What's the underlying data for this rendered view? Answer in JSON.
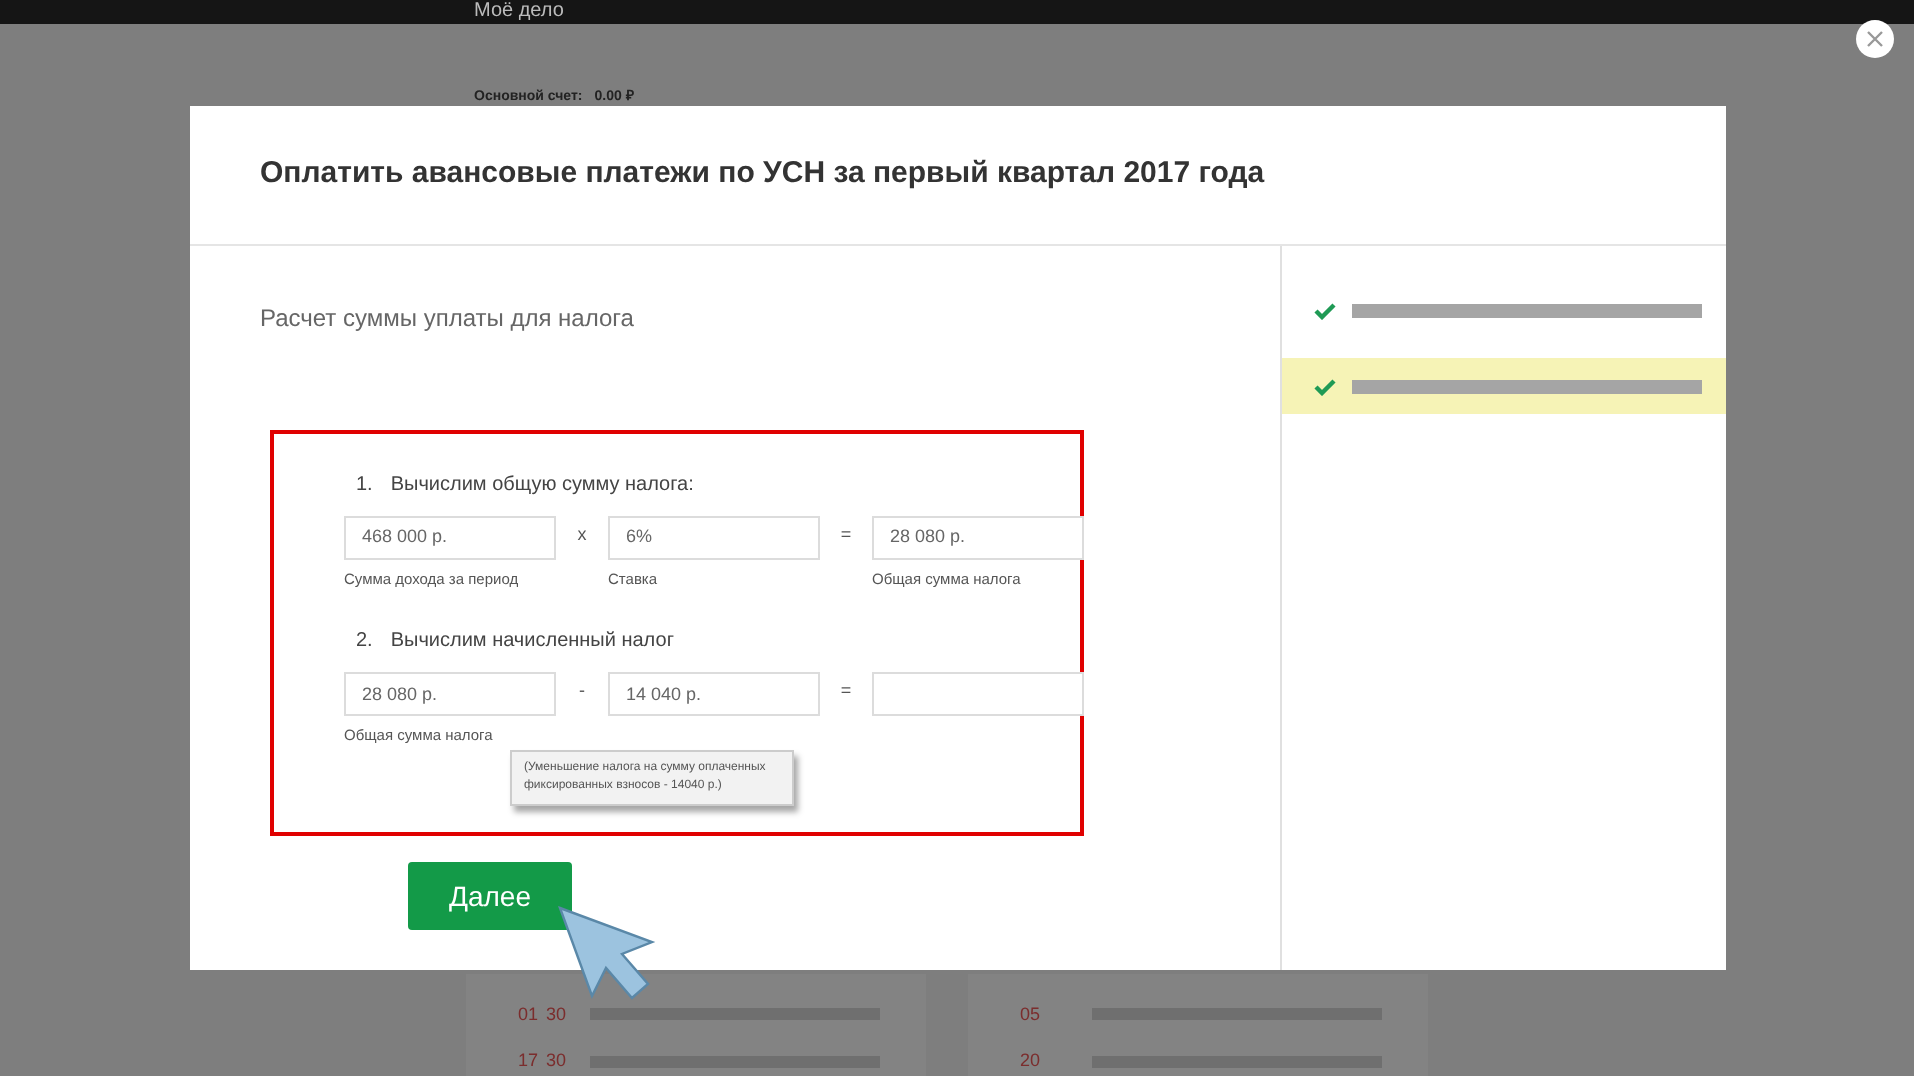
{
  "app_bar": {
    "title": "Моё дело"
  },
  "account": {
    "label": "Основной счет:",
    "value": "0.00 ₽"
  },
  "dialog": {
    "title": "Оплатить авансовые платежи по УСН за первый квартал 2017 года",
    "section_title": "Расчет суммы уплаты для налога",
    "steps": [
      {
        "number": "1.",
        "title": "Вычислим общую сумму налога:",
        "operands": [
          {
            "value": "468 000 р.",
            "caption": "Сумма дохода за период"
          },
          {
            "operator": "x",
            "value": "6%",
            "caption": "Ставка"
          },
          {
            "operator": "=",
            "value": "28 080 р.",
            "caption": "Общая сумма налога"
          }
        ]
      },
      {
        "number": "2.",
        "title": "Вычислим начисленный налог",
        "operands": [
          {
            "value": "28 080 р.",
            "caption": "Общая сумма налога"
          },
          {
            "operator": "-",
            "value": "14 040 р."
          },
          {
            "operator": "="
          }
        ]
      }
    ],
    "tooltip": "(Уменьшение налога на сумму оплаченных фиксированных взносов - 14040 р.)",
    "next_button": "Далее",
    "progress_steps": [
      {
        "checked": true,
        "selected": false
      },
      {
        "checked": true,
        "selected": true
      }
    ]
  },
  "background_cards": [
    {
      "rows": [
        {
          "start": "01",
          "end": "30"
        },
        {
          "start": "17",
          "end": "30"
        }
      ]
    },
    {
      "rows": [
        {
          "start": "05"
        },
        {
          "start": "20"
        }
      ]
    }
  ]
}
